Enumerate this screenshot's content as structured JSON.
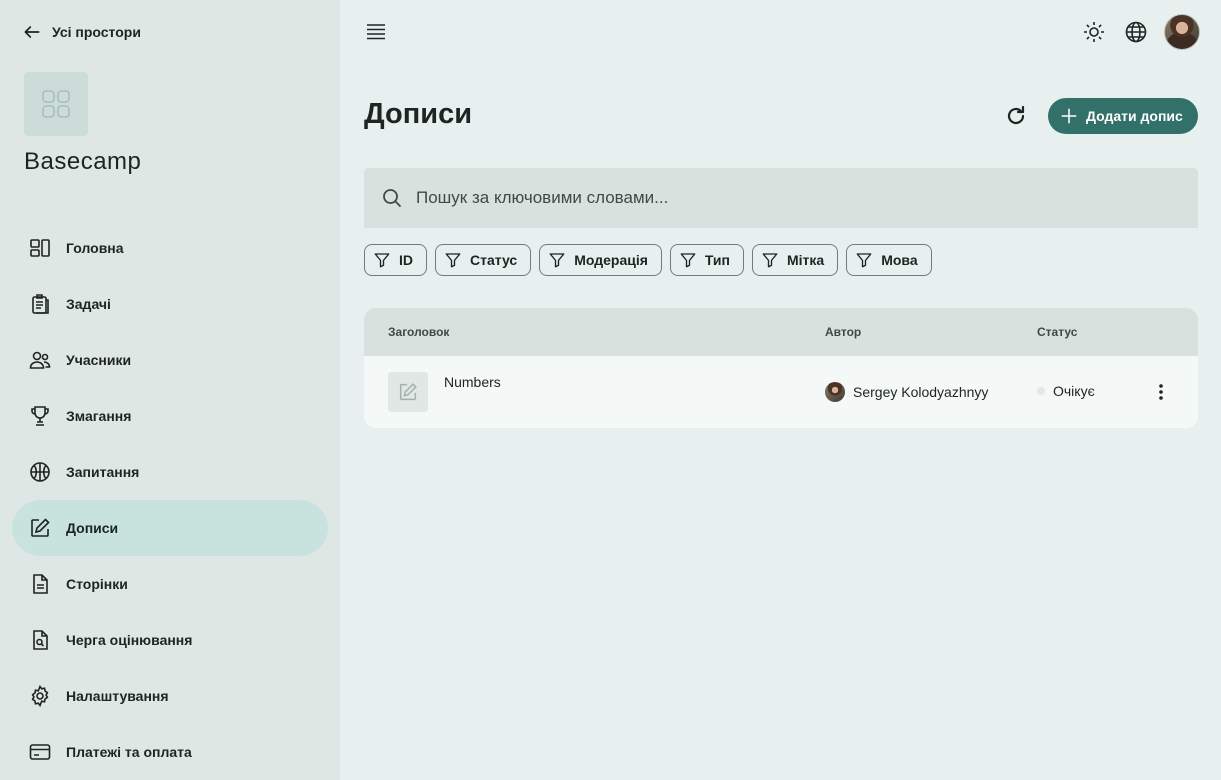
{
  "sidebar": {
    "back_label": "Усі простори",
    "space_name": "Basecamp",
    "items": [
      {
        "label": "Головна",
        "icon": "dashboard-icon"
      },
      {
        "label": "Задачі",
        "icon": "clipboard-icon"
      },
      {
        "label": "Учасники",
        "icon": "people-icon"
      },
      {
        "label": "Змагання",
        "icon": "trophy-icon"
      },
      {
        "label": "Запитання",
        "icon": "ball-icon"
      },
      {
        "label": "Дописи",
        "icon": "edit-icon",
        "active": true
      },
      {
        "label": "Сторінки",
        "icon": "document-icon"
      },
      {
        "label": "Черга оцінювання",
        "icon": "document-search-icon"
      },
      {
        "label": "Налаштування",
        "icon": "gear-icon"
      },
      {
        "label": "Платежі та оплата",
        "icon": "credit-card-icon"
      }
    ]
  },
  "header": {
    "menu_icon": "hamburger-icon",
    "theme_icon": "sun-icon",
    "language_icon": "globe-icon"
  },
  "main": {
    "title": "Дописи",
    "add_button_label": "Додати допис",
    "search_placeholder": "Пошук за ключовими словами...",
    "filters": [
      "ID",
      "Статус",
      "Модерація",
      "Тип",
      "Мітка",
      "Мова"
    ],
    "table": {
      "columns": {
        "title": "Заголовок",
        "author": "Автор",
        "status": "Статус"
      },
      "rows": [
        {
          "title": "Numbers",
          "author": "Sergey Kolodyazhnyy",
          "status": "Очікує"
        }
      ]
    }
  },
  "colors": {
    "accent": "#32706a",
    "active_nav": "#c8e3de",
    "sidebar_bg": "#dfe7e5",
    "page_bg": "#e7f0ee"
  }
}
